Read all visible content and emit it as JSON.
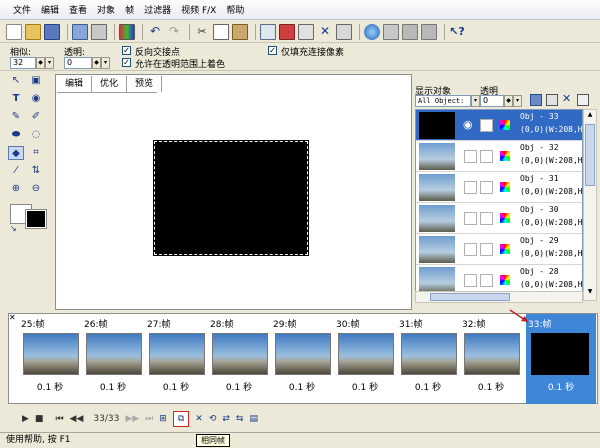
{
  "menu": [
    "文件",
    "编辑",
    "查看",
    "对象",
    "帧",
    "过滤器",
    "视频 F/X",
    "帮助"
  ],
  "options": {
    "similar_label": "相似:",
    "similar_value": "32",
    "transparent_label": "透明:",
    "transparent_value": "0",
    "chk_reverse": "反向交接点",
    "chk_allow": "允许在透明范围上着色",
    "chk_only": "仅填充连接像素"
  },
  "tabs": [
    "编辑",
    "优化",
    "预览"
  ],
  "right": {
    "display_label": "显示对象",
    "transparent_label": "透明",
    "display_value": "All Object:",
    "transparent_value": "0"
  },
  "objects": [
    {
      "name": "Obj - 33",
      "coord": "(0,0)(W:208,H"
    },
    {
      "name": "Obj - 32",
      "coord": "(0,0)(W:208,H"
    },
    {
      "name": "Obj - 31",
      "coord": "(0,0)(W:208,H"
    },
    {
      "name": "Obj - 30",
      "coord": "(0,0)(W:208,H"
    },
    {
      "name": "Obj - 29",
      "coord": "(0,0)(W:208,H"
    },
    {
      "name": "Obj - 28",
      "coord": "(0,0)(W:208,H"
    }
  ],
  "frames": [
    {
      "label": "25:帧",
      "dur": "0.1 秒"
    },
    {
      "label": "26:帧",
      "dur": "0.1 秒"
    },
    {
      "label": "27:帧",
      "dur": "0.1 秒"
    },
    {
      "label": "28:帧",
      "dur": "0.1 秒"
    },
    {
      "label": "29:帧",
      "dur": "0.1 秒"
    },
    {
      "label": "30:帧",
      "dur": "0.1 秒"
    },
    {
      "label": "31:帧",
      "dur": "0.1 秒"
    },
    {
      "label": "32:帧",
      "dur": "0.1 秒"
    },
    {
      "label": "33:帧",
      "dur": "0.1 秒"
    }
  ],
  "playbar": {
    "counter": "33/33"
  },
  "tooltip": "相同帧",
  "status": "使用帮助, 按 F1",
  "colors": {
    "accent": "#3d86d8",
    "selection": "#316ac5",
    "highlight_box": "#d02020"
  }
}
